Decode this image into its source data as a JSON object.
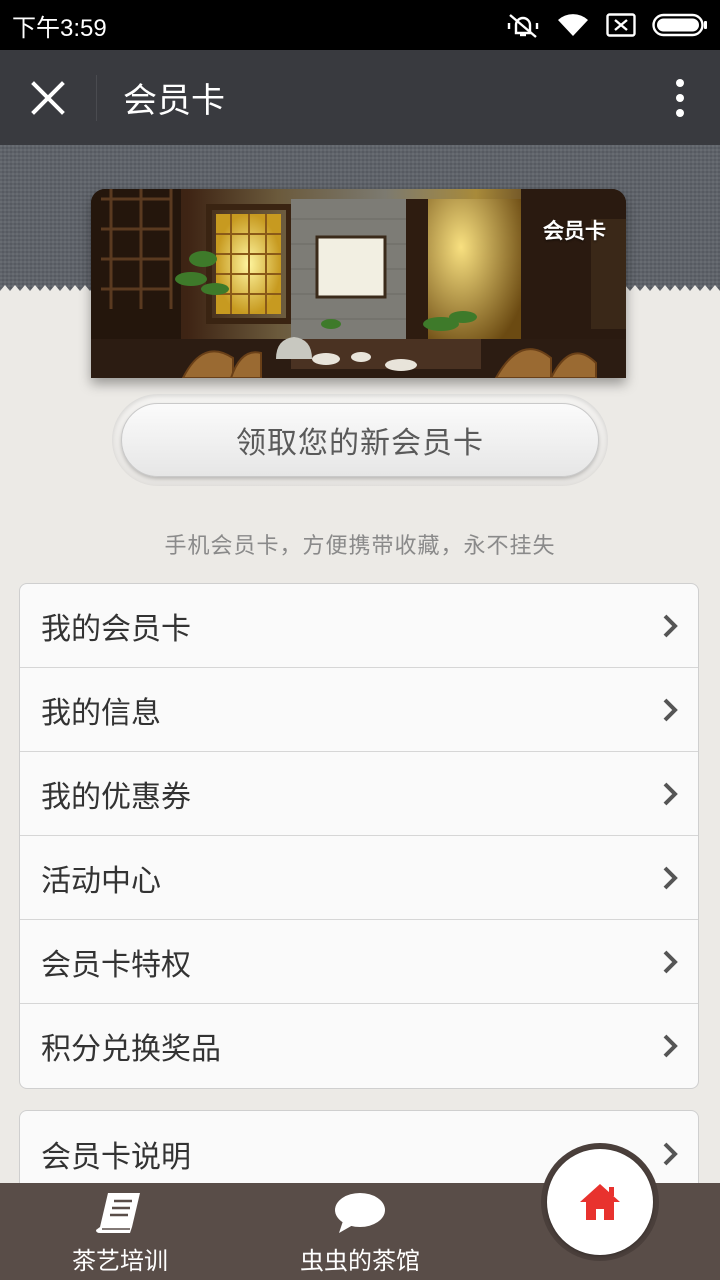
{
  "status_bar": {
    "time": "下午3:59",
    "icons": [
      "vibrate-off-icon",
      "wifi-icon",
      "sim-x-icon",
      "battery-icon"
    ]
  },
  "title_bar": {
    "close_icon": "close-icon",
    "title": "会员卡",
    "more_icon": "more-vertical-icon"
  },
  "card": {
    "label": "会员卡"
  },
  "claim_button": {
    "label": "领取您的新会员卡"
  },
  "tagline": "手机会员卡，方便携带收藏，永不挂失",
  "menu": {
    "items": [
      {
        "label": "我的会员卡"
      },
      {
        "label": "我的信息"
      },
      {
        "label": "我的优惠券"
      },
      {
        "label": "活动中心"
      },
      {
        "label": "会员卡特权"
      },
      {
        "label": "积分兑换奖品"
      }
    ],
    "second": [
      {
        "label": "会员卡说明"
      }
    ]
  },
  "bottom_nav": {
    "items": [
      {
        "label": "茶艺培训",
        "icon": "book-icon"
      },
      {
        "label": "虫虫的茶馆",
        "icon": "chat-bubble-icon"
      }
    ],
    "home_icon": "home-icon",
    "home_color": "#e8322e"
  }
}
